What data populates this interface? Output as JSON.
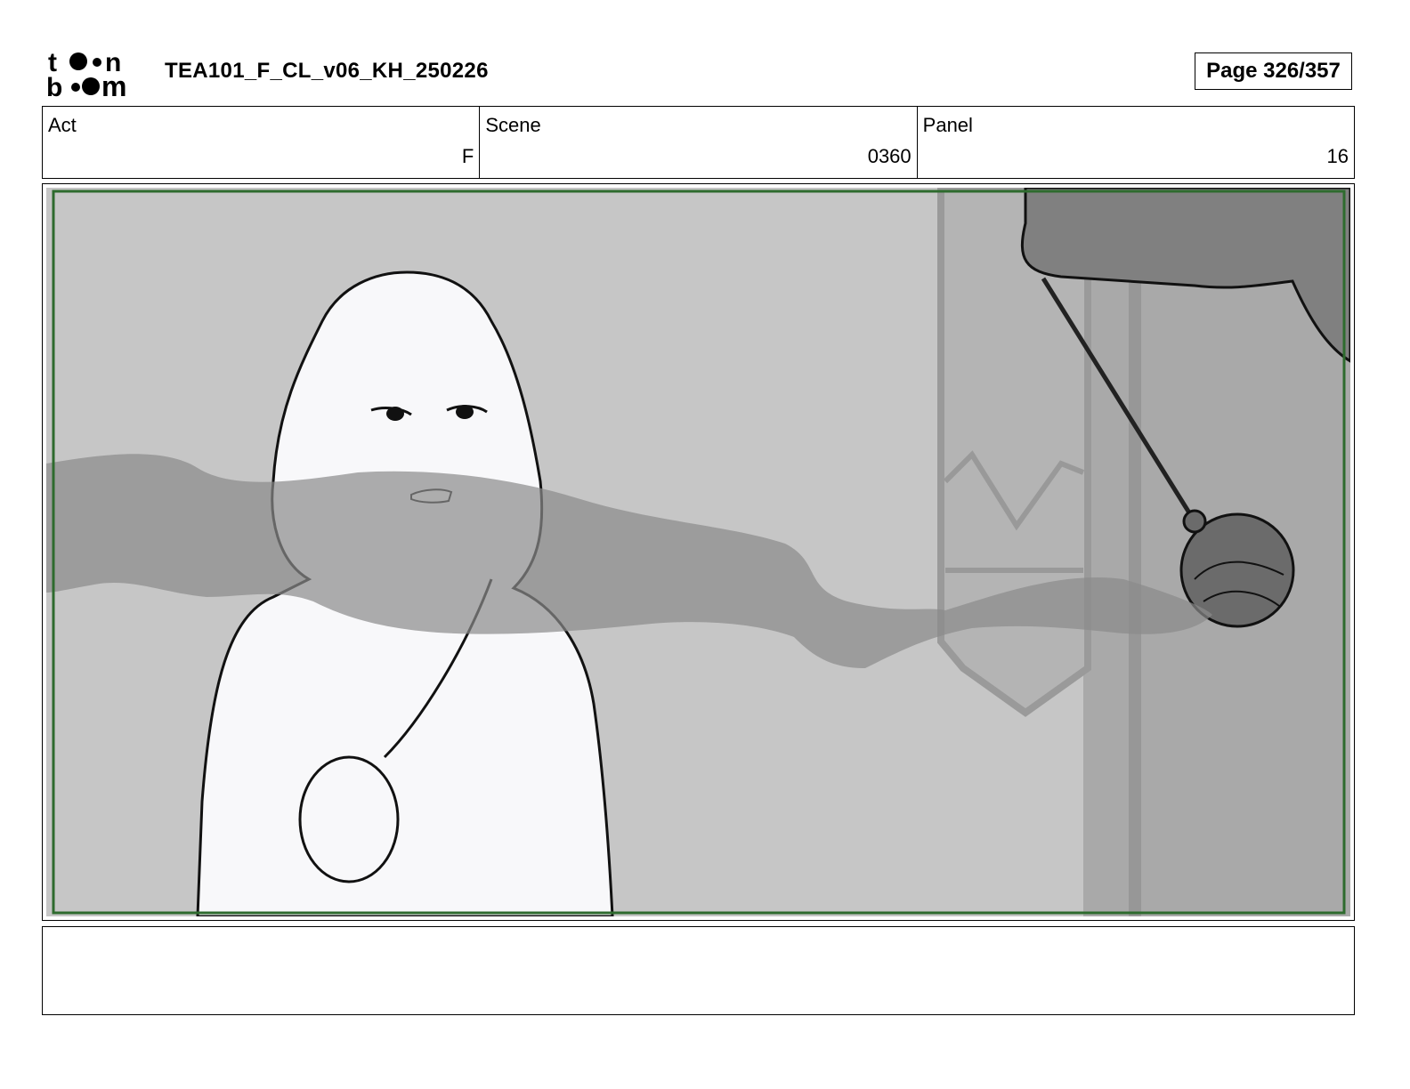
{
  "header": {
    "logo": "toon boom",
    "title": "TEA101_F_CL_v06_KH_250226",
    "page_label": "Page 326/357"
  },
  "info": {
    "act": {
      "label": "Act",
      "value": "F"
    },
    "scene": {
      "label": "Scene",
      "value": "0360"
    },
    "panel": {
      "label": "Panel",
      "value": "16"
    }
  },
  "notes": {
    "text": ""
  },
  "colors": {
    "background_gray": "#c6c6c6",
    "safe_frame_green": "#2e6b2e",
    "figure_white": "#f8f8fa",
    "smoke_gray": "#8a8a8a"
  }
}
